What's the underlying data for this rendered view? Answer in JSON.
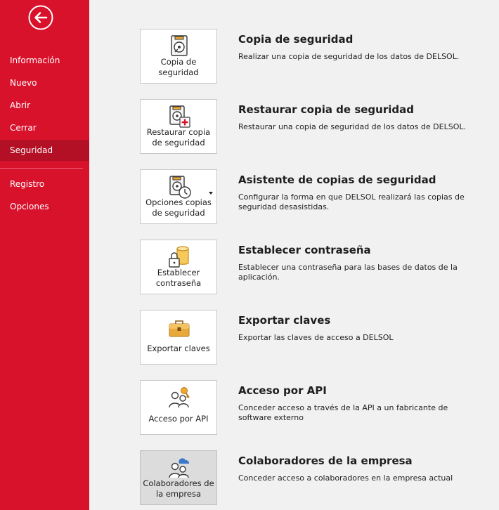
{
  "sidebar": {
    "back_label": "Volver",
    "items": [
      {
        "label": "Información"
      },
      {
        "label": "Nuevo"
      },
      {
        "label": "Abrir"
      },
      {
        "label": "Cerrar"
      },
      {
        "label": "Seguridad",
        "active": true
      },
      {
        "label": "Registro"
      },
      {
        "label": "Opciones"
      }
    ]
  },
  "sections": [
    {
      "button_line1": "Copia de",
      "button_line2": "seguridad",
      "title": "Copia de seguridad",
      "description": "Realizar una copia de seguridad de los datos de DELSOL.",
      "icon": "backup-disk-icon"
    },
    {
      "button_line1": "Restaurar copia",
      "button_line2": "de seguridad",
      "title": "Restaurar copia de seguridad",
      "description": "Restaurar una copia de seguridad de los datos de DELSOL.",
      "icon": "restore-disk-icon"
    },
    {
      "button_line1": "Opciones copias",
      "button_line2": "de seguridad",
      "title": "Asistente de copias de seguridad",
      "description": "Configurar la forma en que DELSOL realizará las copias de seguridad desasistidas.",
      "icon": "backup-schedule-icon",
      "has_dropdown": true
    },
    {
      "button_line1": "Establecer",
      "button_line2": "contraseña",
      "title": "Establecer contraseña",
      "description": "Establecer una contraseña para las bases de datos de la aplicación.",
      "icon": "database-lock-icon"
    },
    {
      "button_line1": "Exportar claves",
      "button_line2": "",
      "title": "Exportar claves",
      "description": "Exportar las claves de acceso a DELSOL",
      "icon": "briefcase-icon"
    },
    {
      "button_line1": "Acceso por API",
      "button_line2": "",
      "title": "Acceso por API",
      "description": "Conceder acceso a través de la API a un fabricante de software externo",
      "icon": "users-key-icon"
    },
    {
      "button_line1": "Colaboradores de",
      "button_line2": "la empresa",
      "title": "Colaboradores de la empresa",
      "description": "Conceder acceso a colaboradores en la empresa actual",
      "icon": "users-cloud-icon",
      "selected": true
    }
  ],
  "colors": {
    "sidebar_bg": "#d9122c",
    "sidebar_active": "#b30f25",
    "page_bg": "#f1f1f1",
    "accent_orange": "#f0a830"
  }
}
